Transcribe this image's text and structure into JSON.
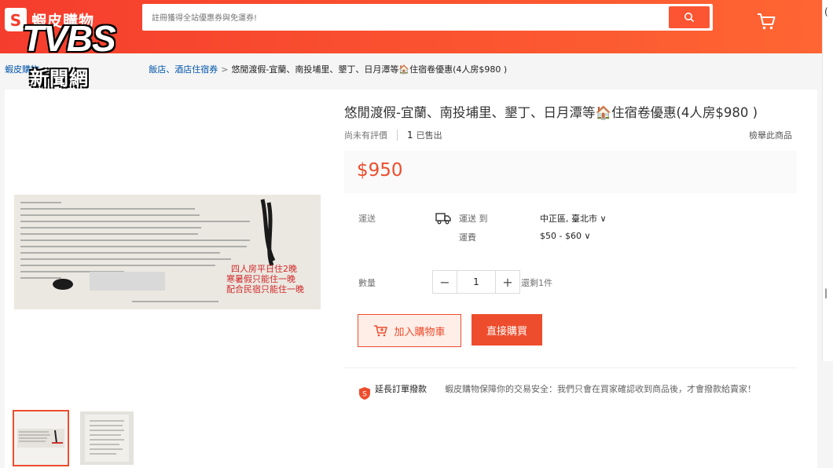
{
  "header": {
    "logo_text": "蝦皮購物",
    "search_placeholder": "註冊獲得全站優惠券與免運券!"
  },
  "watermark": {
    "logo": "TVBS",
    "sub": "新聞網"
  },
  "breadcrumb": {
    "items": [
      "蝦皮購物",
      "飯店、酒店住宿券"
    ],
    "current": "悠閒渡假-宜蘭、南投埔里、墾丁、日月潭等🏠住宿卷優惠(4人房$980 )"
  },
  "product": {
    "title": "悠閒渡假-宜蘭、南投埔里、墾丁、日月潭等🏠住宿卷優惠(4人房$980 )",
    "rating_text": "尚未有評價",
    "sold_count": "1",
    "sold_label": "已售出",
    "report_label": "檢舉此商品",
    "price": "$950"
  },
  "shipping": {
    "label": "運送",
    "to_label": "運送 到",
    "location": "中正區, 臺北市",
    "fee_label": "運費",
    "fee": "$50 - $60"
  },
  "quantity": {
    "label": "數量",
    "minus": "−",
    "value": "1",
    "plus": "+",
    "stock": "還剩1件"
  },
  "buttons": {
    "add_to_cart": "加入購物車",
    "buy_now": "直接購買"
  },
  "guarantee": {
    "title": "延長訂單撥款",
    "text": "蝦皮購物保障你的交易安全：我們只會在買家確認收到商品後，才會撥款給賣家！"
  },
  "photo_text": {
    "stamp_lines": [
      "四人房平日住2晚",
      "寒暑假只能住一晚",
      "配合民宿只能住一晚"
    ]
  },
  "colors": {
    "brand": "#ee4d2d",
    "link": "#0055aa"
  }
}
